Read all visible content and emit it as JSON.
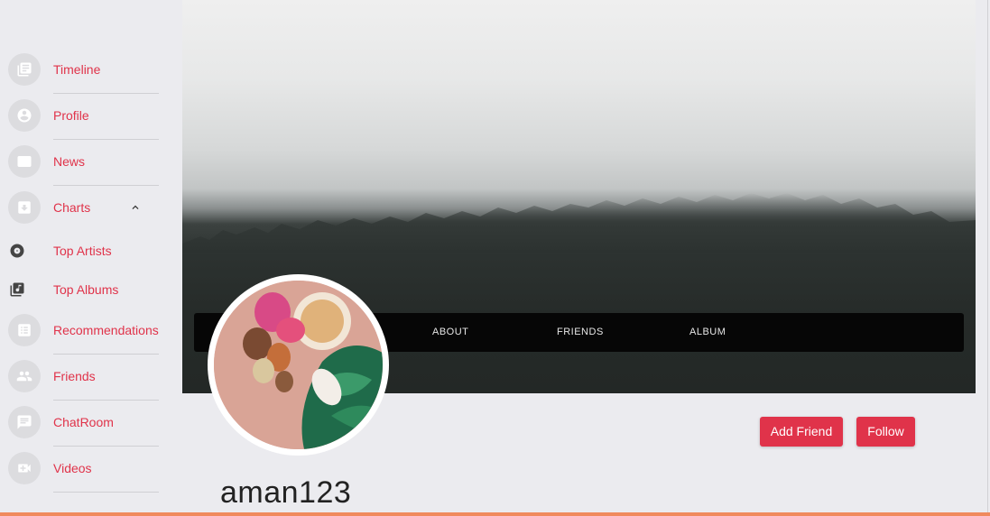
{
  "sidebar": {
    "items": [
      {
        "label": "Timeline",
        "icon": "timeline-icon"
      },
      {
        "label": "Profile",
        "icon": "profile-icon"
      },
      {
        "label": "News",
        "icon": "news-icon"
      },
      {
        "label": "Charts",
        "icon": "charts-icon"
      },
      {
        "label": "Top Artists",
        "icon": "disc-icon"
      },
      {
        "label": "Top Albums",
        "icon": "album-icon"
      },
      {
        "label": "Recommendations",
        "icon": "list-icon"
      },
      {
        "label": "Friends",
        "icon": "friends-icon"
      },
      {
        "label": "ChatRoom",
        "icon": "chat-icon"
      },
      {
        "label": "Videos",
        "icon": "video-icon"
      }
    ]
  },
  "tabs": [
    {
      "label": "ABOUT"
    },
    {
      "label": "FRIENDS"
    },
    {
      "label": "ALBUM"
    }
  ],
  "profile": {
    "username": "aman123"
  },
  "actions": {
    "add_friend": "Add Friend",
    "follow": "Follow"
  },
  "colors": {
    "accent": "#e0334a",
    "background": "#ebebef",
    "bottom_bar": "#f08a5d"
  }
}
